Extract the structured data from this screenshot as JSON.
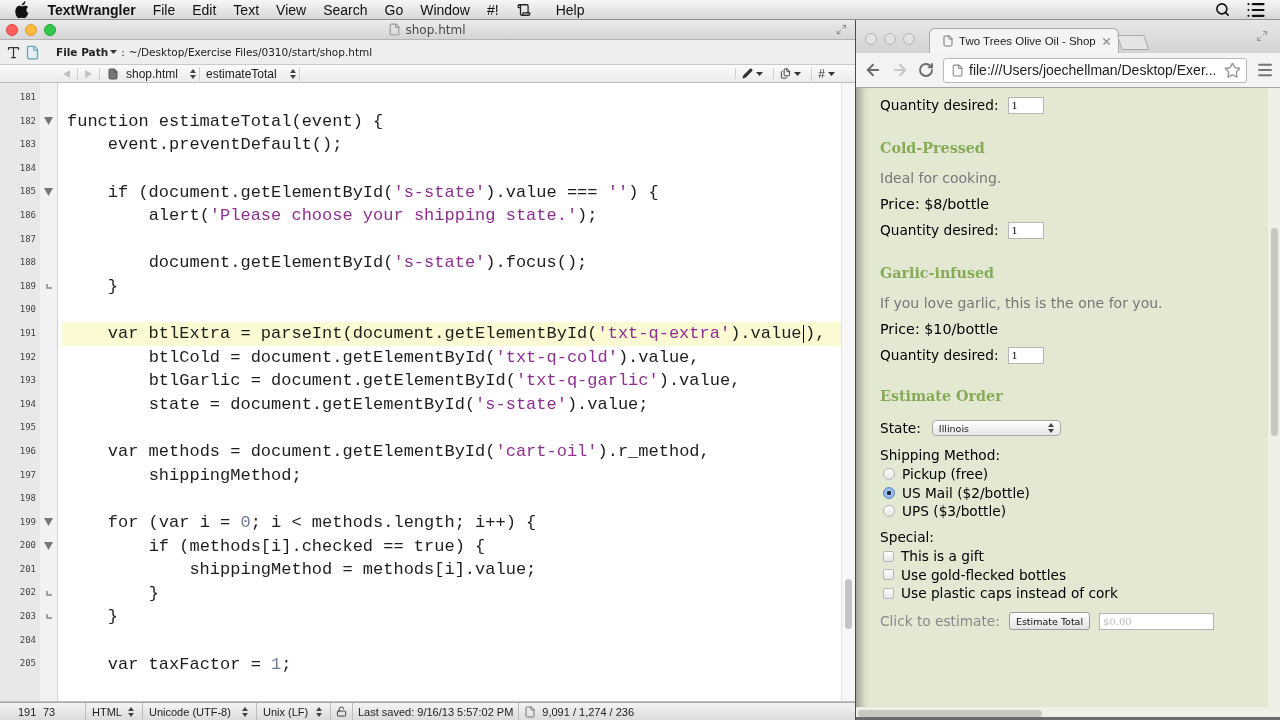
{
  "menu_bar": {
    "items": [
      {
        "kind": "app",
        "label": "TextWrangler"
      },
      {
        "kind": "menu",
        "label": "File"
      },
      {
        "kind": "menu",
        "label": "Edit"
      },
      {
        "kind": "menu",
        "label": "Text"
      },
      {
        "kind": "menu",
        "label": "View"
      },
      {
        "kind": "menu",
        "label": "Search"
      },
      {
        "kind": "menu",
        "label": "Go"
      },
      {
        "kind": "menu",
        "label": "Window"
      },
      {
        "kind": "menu",
        "label": "#!"
      },
      {
        "kind": "script"
      },
      {
        "kind": "menu",
        "label": "Help"
      }
    ]
  },
  "editor": {
    "active": true,
    "title": "shop.html",
    "path_label": "File Path",
    "path_separator": ":",
    "path": "~/Desktop/Exercise Files/0310/start/shop.html",
    "back_disabled": true,
    "forward_disabled": true,
    "file_popup": "shop.html",
    "function_popup": "estimateTotal",
    "hash_menu": "#",
    "lines": [
      {
        "number": "181",
        "current": false
      },
      {
        "number": "182",
        "fold_start": true,
        "current": false,
        "text": "function estimateTotal(event) {"
      },
      {
        "number": "183",
        "current": false,
        "text": "    event.preventDefault();"
      },
      {
        "number": "184",
        "current": false
      },
      {
        "number": "185",
        "fold_start": true,
        "current": false,
        "text": "    if (document.getElementById('s-state').value === '') {"
      },
      {
        "number": "186",
        "current": false,
        "text": "        alert('Please choose your shipping state.');"
      },
      {
        "number": "187",
        "current": false
      },
      {
        "number": "188",
        "current": false,
        "text": "        document.getElementById('s-state').focus();"
      },
      {
        "number": "189",
        "fold_end": true,
        "current": false,
        "text": "    }"
      },
      {
        "number": "190",
        "current": false
      },
      {
        "number": "191",
        "current": true,
        "text": "    var btlExtra = parseInt(document.getElementById('txt-q-extra').value",
        "after_cursor": "),"
      },
      {
        "number": "192",
        "current": false,
        "text": "        btlCold = document.getElementById('txt-q-cold').value,"
      },
      {
        "number": "193",
        "current": false,
        "text": "        btlGarlic = document.getElementById('txt-q-garlic').value,"
      },
      {
        "number": "194",
        "current": false,
        "text": "        state = document.getElementById('s-state').value;"
      },
      {
        "number": "195",
        "current": false
      },
      {
        "number": "196",
        "current": false,
        "text": "    var methods = document.getElementById('cart-oil').r_method,"
      },
      {
        "number": "197",
        "current": false,
        "text": "        shippingMethod;"
      },
      {
        "number": "198",
        "current": false
      },
      {
        "number": "199",
        "fold_start": true,
        "current": false,
        "text": "    for (var i = 0; i < methods.length; i++) {"
      },
      {
        "number": "200",
        "fold_start": true,
        "current": false,
        "text": "        if (methods[i].checked == true) {"
      },
      {
        "number": "201",
        "current": false,
        "text": "            shippingMethod = methods[i].value;"
      },
      {
        "number": "202",
        "fold_end": true,
        "current": false,
        "text": "        }"
      },
      {
        "number": "203",
        "fold_end": true,
        "current": false,
        "text": "    }"
      },
      {
        "number": "204",
        "current": false
      },
      {
        "number": "205",
        "current": false,
        "text": "    var taxFactor = 1;"
      }
    ],
    "status_bar": {
      "line": "191",
      "column": "73",
      "language": "HTML",
      "encoding": "Unicode (UTF-8)",
      "line_endings": "Unix (LF)",
      "last_saved": "Last saved: 9/16/13 5:57:02 PM",
      "counts": "9,091 / 1,274 / 236"
    }
  },
  "browser": {
    "active": false,
    "tabs": [
      {
        "title": "Two Trees Olive Oil - Shop",
        "selected": true
      }
    ],
    "back_disabled": false,
    "forward_disabled": true,
    "address": "file:///Users/joechellman/Desktop/Exer...",
    "page": {
      "products": [
        {
          "quantity_label": "Quantity desired:",
          "quantity": "1"
        },
        {
          "name": "Cold-Pressed",
          "description": "Ideal for cooking.",
          "price": "Price: $8/bottle",
          "quantity_label": "Quantity desired:",
          "quantity": "1"
        },
        {
          "name": "Garlic-infused",
          "description": "If you love garlic, this is the one for you.",
          "price": "Price: $10/bottle",
          "quantity_label": "Quantity desired:",
          "quantity": "1"
        }
      ],
      "estimate": {
        "heading": "Estimate Order",
        "state_label": "State:",
        "state": "Illinois",
        "shipping_label": "Shipping Method:",
        "shipping_options": [
          {
            "label": "Pickup (free)",
            "selected": false
          },
          {
            "label": "US Mail ($2/bottle)",
            "selected": true
          },
          {
            "label": "UPS ($3/bottle)",
            "selected": false
          }
        ],
        "special_label": "Special:",
        "special_options": [
          {
            "label": "This is a gift",
            "checked": false
          },
          {
            "label": "Use gold-flecked bottles",
            "checked": false
          },
          {
            "label": "Use plastic caps instead of cork",
            "checked": false
          }
        ],
        "estimate_label": "Click to estimate:",
        "button": "Estimate Total",
        "total_placeholder": "$0.00"
      }
    }
  }
}
